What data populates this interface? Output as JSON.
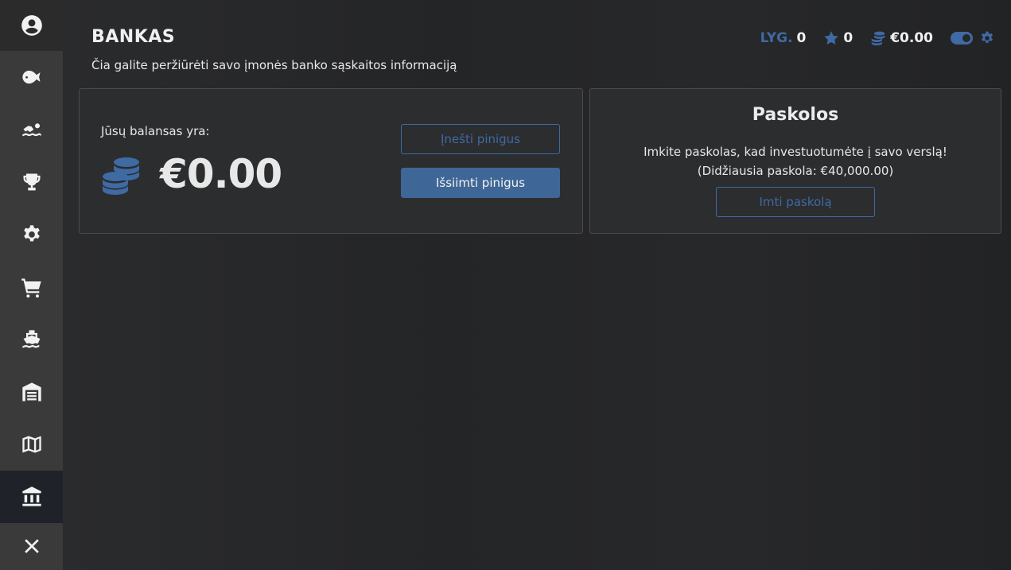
{
  "page": {
    "title": "BANKAS",
    "subtitle": "Čia galite peržiūrėti savo įmonės banko sąskaitos informaciją"
  },
  "topbar": {
    "level_label": "LYG.",
    "level_value": "0",
    "stars_value": "0",
    "money_value": "€0.00",
    "toggle_state": "on"
  },
  "balance": {
    "label": "Jūsų balansas yra:",
    "amount": "€0.00",
    "deposit_label": "Įnešti pinigus",
    "withdraw_label": "Išsiimti pinigus"
  },
  "loans": {
    "title": "Paskolos",
    "description": "Imkite paskolas, kad investuotumėte į savo verslą!",
    "max_loan": "(Didžiausia paskola: €40,000.00)",
    "take_loan_label": "Imti paskolą"
  },
  "sidebar": {
    "items": [
      {
        "icon": "user-circle-icon"
      },
      {
        "icon": "fish-icon"
      },
      {
        "icon": "swimmer-icon"
      },
      {
        "icon": "trophy-icon"
      },
      {
        "icon": "gear-icon"
      },
      {
        "icon": "cart-icon"
      },
      {
        "icon": "ship-icon"
      },
      {
        "icon": "warehouse-icon"
      },
      {
        "icon": "map-icon"
      },
      {
        "icon": "bank-icon",
        "active": true
      },
      {
        "icon": "close-icon"
      }
    ]
  },
  "colors": {
    "accent": "#3f6aa3",
    "background": "#262729",
    "card": "#2c2d2f",
    "sidebar": "#3a3a3a"
  }
}
